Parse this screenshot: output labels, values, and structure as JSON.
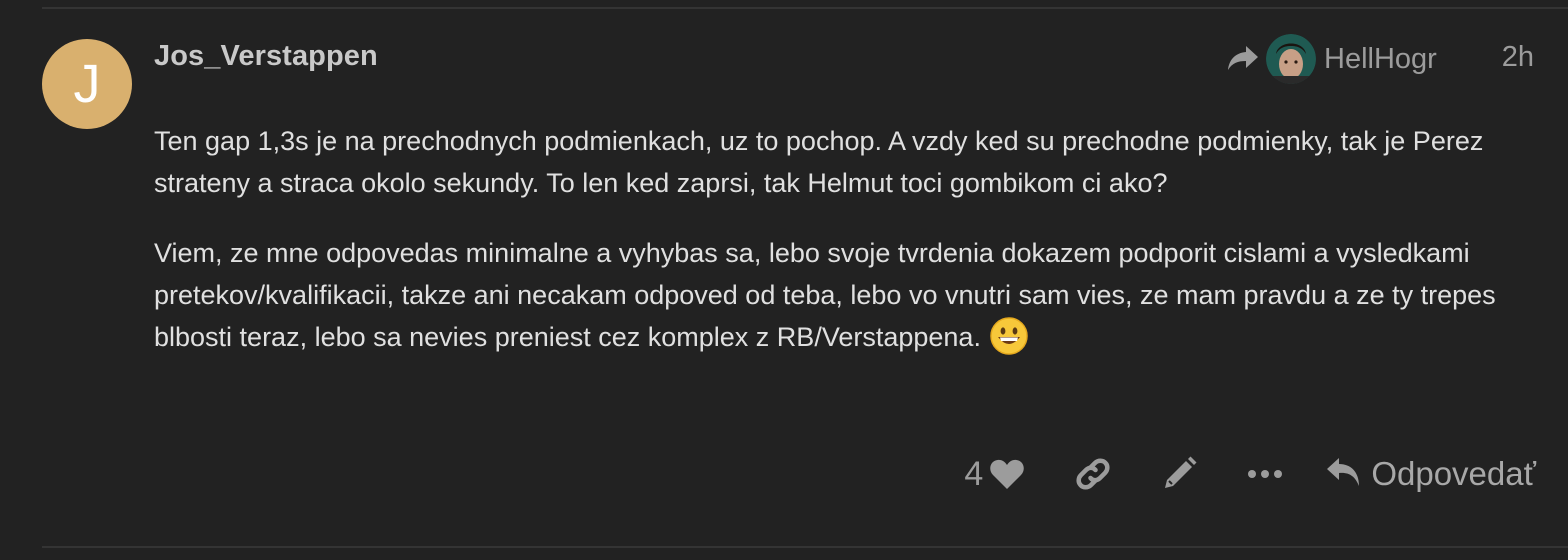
{
  "post": {
    "author": {
      "username": "Jos_Verstappen",
      "avatar_letter": "J",
      "avatar_color": "#d9b06e"
    },
    "reply_to": {
      "username": "HellHogr",
      "icon": "share-arrow-icon"
    },
    "date": "2h",
    "paragraphs": [
      "Ten gap 1,3s je na prechodnych podmienkach, uz to pochop. A vzdy ked su prechodne podmienky, tak je Perez strateny a straca okolo sekundy. To len ked zaprsi, tak Helmut toci gombikom ci ako?",
      "Viem, ze mne odpovedas minimalne a vyhybas sa, lebo svoje tvrdenia dokazem podporit cislami a vysledkami pretekov/kvalifikacii, takze ani necakam odpoved od teba, lebo vo vnutri sam vies, ze mam pravdu a ze ty trepes blbosti teraz, lebo sa nevies preniest cez komplex z RB/Verstappena."
    ],
    "emoji": "grinning-face"
  },
  "actions": {
    "like_count": "4",
    "reply_label": "Odpovedať",
    "icons": [
      "heart-icon",
      "link-icon",
      "pencil-icon",
      "more-icon",
      "reply-icon"
    ]
  },
  "colors": {
    "background": "#222222",
    "muted": "#9c9c9c",
    "text": "#e0e0e0"
  }
}
